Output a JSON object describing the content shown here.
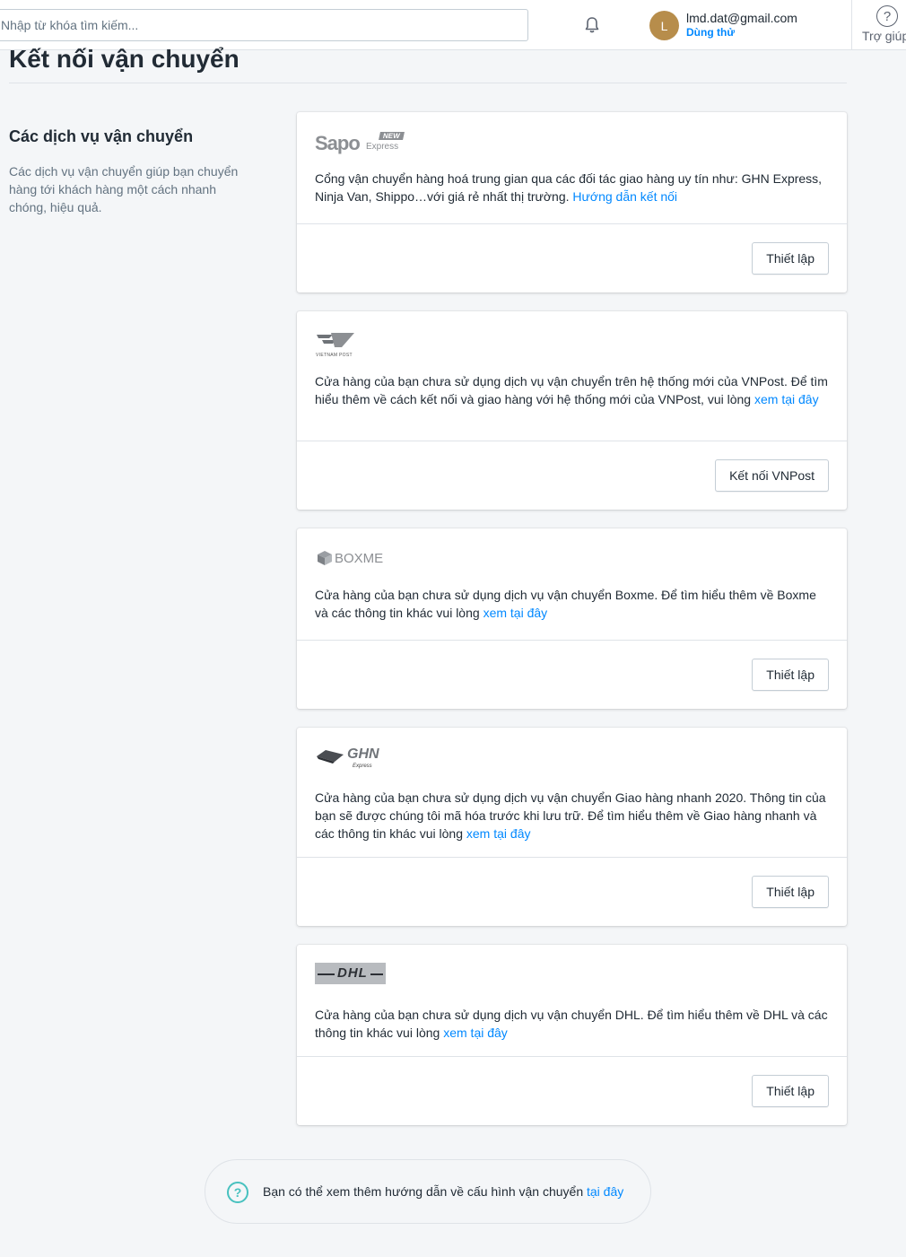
{
  "header": {
    "search_placeholder": "Nhập từ khóa tìm kiếm...",
    "avatar_initial": "L",
    "avatar_color": "#b78d4b",
    "user_email": "lmd.dat@gmail.com",
    "user_plan": "Dùng thử",
    "help_label": "Trợ giúp"
  },
  "page": {
    "title": "Kết nối vận chuyển"
  },
  "section": {
    "heading": "Các dịch vụ vận chuyển",
    "description": "Các dịch vụ vận chuyển giúp bạn chuyển hàng tới khách hàng một cách nhanh chóng, hiệu quả."
  },
  "carriers": [
    {
      "logo_text": "Sapo",
      "logo_sub": "Express",
      "logo_badge": "NEW",
      "text": "Cổng vận chuyển hàng hoá trung gian qua các đối tác giao hàng uy tín như: GHN Express, Ninja Van, Shippo…với giá rẻ nhất thị trường. ",
      "link": "Hướng dẫn kết nối",
      "button": "Thiết lập"
    },
    {
      "logo_text": "VIETNAM POST",
      "text": "Cửa hàng của bạn chưa sử dụng dịch vụ vận chuyển trên hệ thống mới của VNPost. Để tìm hiểu thêm về cách kết nối và giao hàng với hệ thống mới của VNPost, vui lòng ",
      "link": "xem tại đây",
      "button": "Kết nối VNPost"
    },
    {
      "logo_text": "BOXME",
      "text": "Cửa hàng của bạn chưa sử dụng dịch vụ vận chuyển Boxme. Để tìm hiểu thêm về Boxme và các thông tin khác vui lòng ",
      "link": "xem tại đây",
      "button": "Thiết lập"
    },
    {
      "logo_text": "GHN",
      "logo_sub": "Express",
      "text": "Cửa hàng của bạn chưa sử dụng dịch vụ vận chuyển Giao hàng nhanh 2020. Thông tin của bạn sẽ được chúng tôi mã hóa trước khi lưu trữ. Để tìm hiểu thêm về Giao hàng nhanh và các thông tin khác vui lòng ",
      "link": "xem tại đây",
      "button": "Thiết lập"
    },
    {
      "logo_text": "DHL",
      "text": "Cửa hàng của bạn chưa sử dụng dịch vụ vận chuyển DHL. Để tìm hiểu thêm về DHL và các thông tin khác vui lòng ",
      "link": "xem tại đây",
      "button": "Thiết lập"
    }
  ],
  "footer_help": {
    "text": "Bạn có thể xem thêm hướng dẫn về cấu hình vận chuyển ",
    "link": "tại đây",
    "icon": "question-circle-icon"
  },
  "colors": {
    "link": "#0088ff",
    "help_icon": "#47c1bf"
  }
}
